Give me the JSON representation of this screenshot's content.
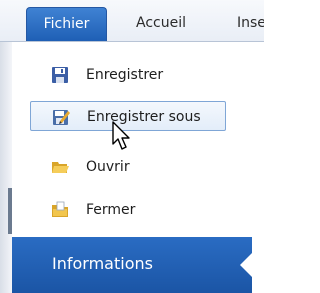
{
  "ribbon": {
    "tabs": [
      {
        "label": "Fichier"
      },
      {
        "label": "Accueil"
      },
      {
        "label": "Insertion"
      }
    ]
  },
  "backstage": {
    "items": [
      {
        "label": "Enregistrer",
        "icon": "floppy-disk-icon"
      },
      {
        "label": "Enregistrer sous",
        "icon": "save-as-icon"
      },
      {
        "label": "Ouvrir",
        "icon": "open-folder-icon"
      },
      {
        "label": "Fermer",
        "icon": "close-folder-icon"
      }
    ],
    "info": {
      "label": "Informations"
    }
  },
  "colors": {
    "accent": "#1f5fb5",
    "hover_border": "#7fa6d6"
  }
}
